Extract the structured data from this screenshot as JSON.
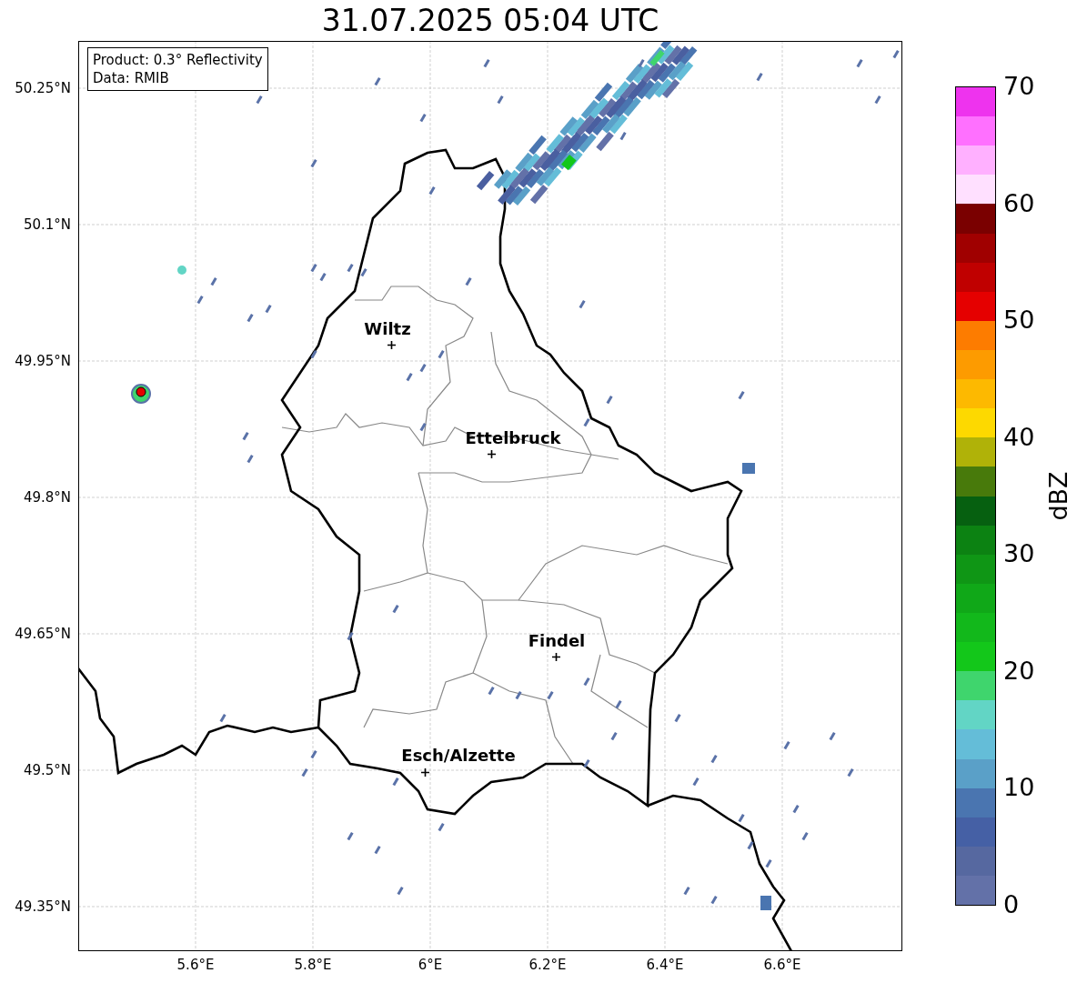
{
  "title": "31.07.2025 05:04 UTC",
  "info_box": [
    "Product: 0.3° Reflectivity",
    "Data: RMIB"
  ],
  "lat_ticks": [
    "50.25°N",
    "50.1°N",
    "49.95°N",
    "49.8°N",
    "49.65°N",
    "49.5°N",
    "49.35°N"
  ],
  "lon_ticks": [
    "5.6°E",
    "5.8°E",
    "6°E",
    "6.2°E",
    "6.4°E",
    "6.6°E"
  ],
  "cities": [
    {
      "name": "Wiltz"
    },
    {
      "name": "Ettelbruck"
    },
    {
      "name": "Findel"
    },
    {
      "name": "Esch/Alzette"
    }
  ],
  "colorbar": {
    "label": "dBZ",
    "ticks": [
      "70",
      "60",
      "50",
      "40",
      "30",
      "20",
      "10",
      "0"
    ],
    "bins": [
      {
        "color": "#ee33ee"
      },
      {
        "color": "#ff70ff"
      },
      {
        "color": "#ffb0ff"
      },
      {
        "color": "#ffe0ff"
      },
      {
        "color": "#7a0000"
      },
      {
        "color": "#a00000"
      },
      {
        "color": "#c00000"
      },
      {
        "color": "#e50000"
      },
      {
        "color": "#fd7c00"
      },
      {
        "color": "#fd9b00"
      },
      {
        "color": "#fdb900"
      },
      {
        "color": "#fdd900"
      },
      {
        "color": "#b0b208"
      },
      {
        "color": "#487a0b"
      },
      {
        "color": "#066010"
      },
      {
        "color": "#0c8212"
      },
      {
        "color": "#0f9615"
      },
      {
        "color": "#10a818"
      },
      {
        "color": "#12b81b"
      },
      {
        "color": "#13c71a"
      },
      {
        "color": "#3fd56d"
      },
      {
        "color": "#62d5c5"
      },
      {
        "color": "#64bdd8"
      },
      {
        "color": "#5aa0c8"
      },
      {
        "color": "#4a75b0"
      },
      {
        "color": "#4560a5"
      },
      {
        "color": "#5668a0"
      },
      {
        "color": "#6371a8"
      }
    ]
  }
}
